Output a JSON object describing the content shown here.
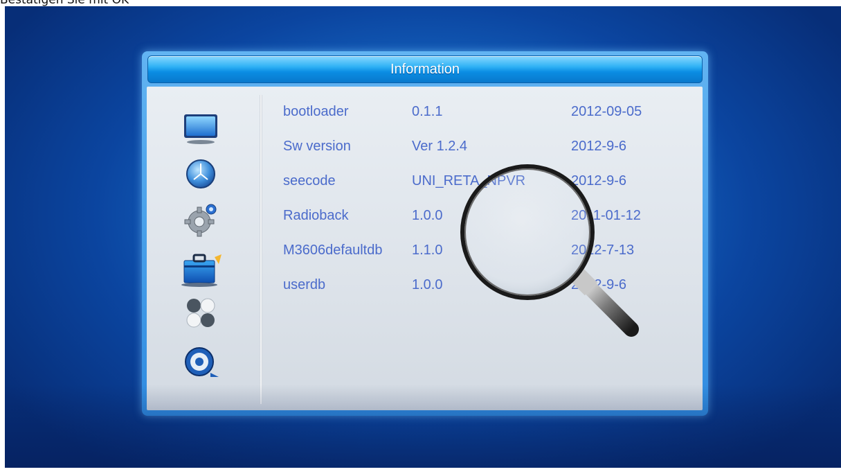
{
  "caption": "Bestätigen Sie mit OK",
  "window": {
    "title": "Information"
  },
  "sidebar": {
    "items": [
      {
        "icon": "tv-screen-icon"
      },
      {
        "icon": "satellite-dish-icon"
      },
      {
        "icon": "gear-icon"
      },
      {
        "icon": "toolbox-icon"
      },
      {
        "icon": "balls-icon"
      },
      {
        "icon": "media-disc-icon"
      }
    ]
  },
  "info_table": {
    "rows": [
      {
        "name": "bootloader",
        "version": "0.1.1",
        "date": "2012-09-05"
      },
      {
        "name": "Sw version",
        "version": "Ver 1.2.4",
        "date": "2012-9-6"
      },
      {
        "name": "seecode",
        "version": "UNI_RETA_NPVR",
        "date": "2012-9-6"
      },
      {
        "name": "Radioback",
        "version": "1.0.0",
        "date": "2011-01-12"
      },
      {
        "name": "M3606defaultdb",
        "version": "1.1.0",
        "date": "2012-7-13"
      },
      {
        "name": "userdb",
        "version": "1.0.0",
        "date": "2012-9-6"
      }
    ]
  },
  "colors": {
    "text": "#4b6bcb",
    "titlebar": "#0b8de3",
    "background": "#1668c4"
  }
}
